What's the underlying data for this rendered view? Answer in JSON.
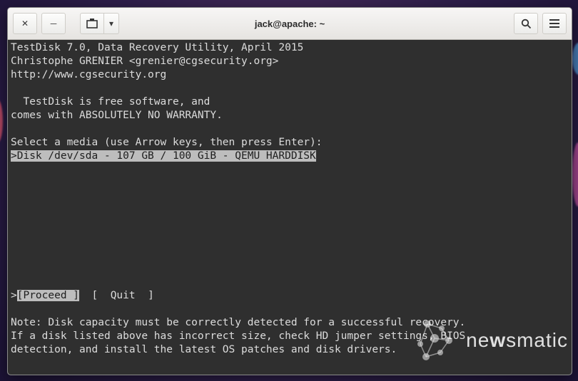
{
  "window": {
    "title": "jack@apache: ~"
  },
  "testdisk": {
    "header1": "TestDisk 7.0, Data Recovery Utility, April 2015",
    "header2": "Christophe GRENIER <grenier@cgsecurity.org>",
    "header3": "http://www.cgsecurity.org",
    "intro1": "  TestDisk is free software, and",
    "intro2": "comes with ABSOLUTELY NO WARRANTY.",
    "prompt": "Select a media (use Arrow keys, then press Enter):",
    "disk_line": ">Disk /dev/sda - 107 GB / 100 GiB - QEMU HARDDISK",
    "menu_row": {
      "prefix": ">",
      "proceed": "[Proceed ]",
      "gap": "  ",
      "quit": "[  Quit  ]"
    },
    "note1": "Note: Disk capacity must be correctly detected for a successful recovery.",
    "note2": "If a disk listed above has incorrect size, check HD jumper settings, BIOS",
    "note3": "detection, and install the latest OS patches and disk drivers."
  },
  "watermark": {
    "brand_a": "ne",
    "brand_b": "w",
    "brand_c": "smatic"
  }
}
